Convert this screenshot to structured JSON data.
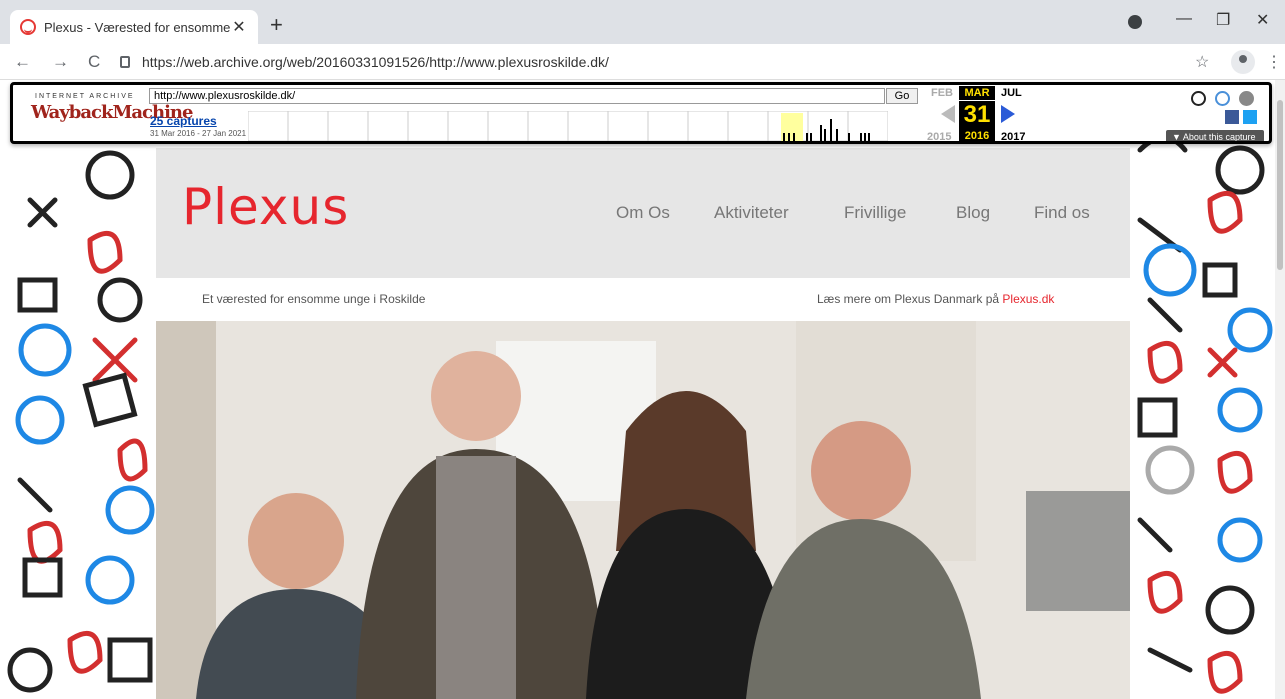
{
  "browser": {
    "tab_title": "Plexus - Værested for ensomme u",
    "tab_close": "✕",
    "new_tab": "+",
    "url": "https://web.archive.org/web/20160331091526/http://www.plexusroskilde.dk/",
    "window_controls": {
      "minimize": "—",
      "restore": "❐",
      "close": "✕"
    },
    "nav": {
      "back": "←",
      "forward": "→",
      "reload": "C"
    },
    "star": "☆",
    "menu": "⋮"
  },
  "wayback": {
    "brand_line1": "INTERNET ARCHIVE",
    "brand_line2": "WaybackMachine",
    "url_value": "http://www.plexusroskilde.dk/",
    "go_label": "Go",
    "captures_link": "25 captures",
    "capture_range": "31 Mar 2016 - 27 Jan 2021",
    "prev_month": "FEB",
    "current_month": "MAR",
    "next_month": "JUL",
    "current_day": "31",
    "prev_year": "2015",
    "current_year": "2016",
    "next_year": "2017",
    "about_label": "▼ About this capture"
  },
  "site": {
    "logo_text": "Plexus",
    "nav_items": [
      "Om Os",
      "Aktiviteter",
      "Frivillige",
      "Blog",
      "Find os"
    ],
    "tagline": "Et værested for ensomme unge i Roskilde",
    "more_text": "Læs mere om Plexus Danmark på ",
    "more_link": "Plexus.dk"
  },
  "colors": {
    "brand_red": "#e6262e",
    "header_grey": "#e6e6e6",
    "wayback_yellow": "#ffe000"
  }
}
